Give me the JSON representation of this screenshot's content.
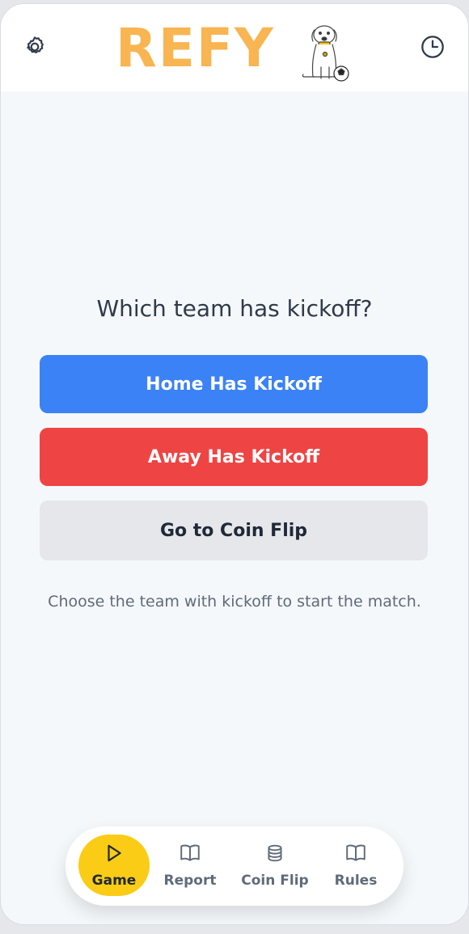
{
  "app": {
    "logo_text": "REFY",
    "brand_color": "#f8b551"
  },
  "header": {
    "settings_icon": "gear-icon",
    "history_icon": "clock-icon"
  },
  "main": {
    "question": "Which team has kickoff?",
    "home_button": "Home Has Kickoff",
    "away_button": "Away Has Kickoff",
    "coin_button": "Go to Coin Flip",
    "hint": "Choose the team with kickoff to start the match."
  },
  "colors": {
    "home": "#3b82f6",
    "away": "#ef4444",
    "neutral": "#e5e7eb",
    "active_nav": "#facc15"
  },
  "nav": {
    "items": [
      {
        "label": "Game",
        "icon": "play-icon",
        "active": true
      },
      {
        "label": "Report",
        "icon": "book-icon",
        "active": false
      },
      {
        "label": "Coin Flip",
        "icon": "coins-icon",
        "active": false
      },
      {
        "label": "Rules",
        "icon": "book-icon",
        "active": false
      }
    ]
  }
}
